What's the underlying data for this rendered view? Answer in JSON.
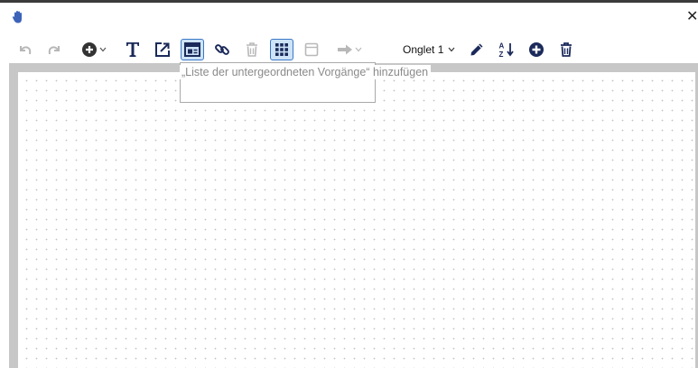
{
  "window": {
    "close_label": "✕"
  },
  "toolbar": {
    "icons": [
      "undo-icon",
      "redo-icon",
      "add-circle-icon",
      "text-icon",
      "export-link-icon",
      "subprocess-list-icon",
      "link-icon",
      "trash-icon",
      "grid-icon",
      "frame-icon",
      "arrow-right-icon",
      "pencil-icon",
      "sort-az-icon",
      "add-circle-icon",
      "trash-icon"
    ],
    "tab_select": {
      "value": "Onglet 1"
    },
    "selected_tools": [
      "add-subprocess-list-button",
      "grid-toggle-button"
    ]
  },
  "tooltip": {
    "text": "„Liste der untergeordneten Vorgänge“ hinzufügen"
  },
  "colors": {
    "icon_dark": "#1b2a5a",
    "icon_disabled": "#b8b8b8",
    "accent": "#3a77c8",
    "canvas_frame": "#c7c7c7"
  }
}
